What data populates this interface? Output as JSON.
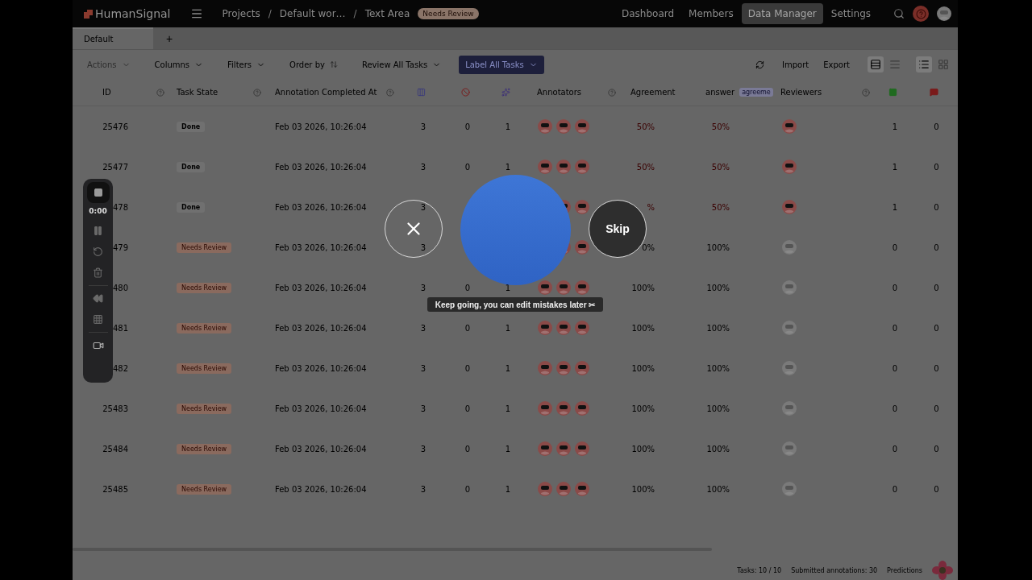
{
  "nav": {
    "logo": "HumanSignal",
    "breadcrumbs": [
      {
        "kind": "link",
        "label": "Projects"
      },
      {
        "kind": "separator",
        "label": "/"
      },
      {
        "kind": "link",
        "label": "Default wor…"
      },
      {
        "kind": "separator",
        "label": "/"
      },
      {
        "kind": "link",
        "label": "Text Area"
      }
    ],
    "status_badge": "Needs Review",
    "links": [
      {
        "label": "Dashboard",
        "selected": false
      },
      {
        "label": "Members",
        "selected": false
      },
      {
        "label": "Data Manager",
        "selected": true
      },
      {
        "label": "Settings",
        "selected": false
      }
    ]
  },
  "tabs": [
    {
      "label": "Default",
      "selected": true
    }
  ],
  "add_tab": "+",
  "toolbar": {
    "buttons": [
      {
        "label": "Actions",
        "kind": "menu",
        "disabled": true
      },
      {
        "label": "Columns",
        "kind": "menu",
        "disabled": false
      },
      {
        "label": "Filters",
        "kind": "menu",
        "disabled": false
      },
      {
        "label": "Order by",
        "kind": "sort",
        "disabled": false
      },
      {
        "label": "Review All Tasks",
        "kind": "menu",
        "disabled": false
      },
      {
        "label": "Label All Tasks",
        "kind": "primary",
        "disabled": false
      }
    ],
    "actions": [
      "Import",
      "Export"
    ],
    "density_modes": [
      {
        "selected": true
      },
      {
        "selected": false
      }
    ],
    "view_modes": [
      {
        "selected": true
      },
      {
        "selected": false
      }
    ]
  },
  "table": {
    "columns": [
      {
        "kind": "text",
        "label": "ID",
        "help": true
      },
      {
        "kind": "text",
        "label": "Task State",
        "help": true
      },
      {
        "kind": "text",
        "label": "Annotation Completed At",
        "help": true
      },
      {
        "kind": "icon"
      },
      {
        "kind": "icon"
      },
      {
        "kind": "icon"
      },
      {
        "kind": "text",
        "label": "Annotators",
        "help": true
      },
      {
        "kind": "text",
        "label": "Agreement",
        "help": false
      },
      {
        "kind": "text",
        "label": "answer",
        "help": false,
        "badge": "agreeme"
      },
      {
        "kind": "text",
        "label": "Reviewers",
        "help": true
      },
      {
        "kind": "icon"
      },
      {
        "kind": "icon"
      }
    ],
    "rows": [
      {
        "id": "25476",
        "state": "Done",
        "kind": "done",
        "completed_at": "Feb 03 2026, 10:26:04",
        "total": "3",
        "cancelled": "0",
        "predictions": "1",
        "annotators": [
          {
            "kind": "avatar"
          },
          {
            "kind": "avatar"
          },
          {
            "kind": "avatar"
          }
        ],
        "agreement": "50%",
        "answer": "50%",
        "low": true,
        "reviewed": true,
        "reviews": "1",
        "column_12": "0"
      },
      {
        "id": "25477",
        "state": "Done",
        "kind": "done",
        "completed_at": "Feb 03 2026, 10:26:04",
        "total": "3",
        "cancelled": "0",
        "predictions": "1",
        "annotators": [
          {
            "kind": "avatar"
          },
          {
            "kind": "avatar"
          },
          {
            "kind": "avatar"
          }
        ],
        "agreement": "50%",
        "answer": "50%",
        "low": true,
        "reviewed": true,
        "reviews": "1",
        "column_12": "0"
      },
      {
        "id": "478",
        "state": "Done",
        "kind": "done",
        "completed_at": "Feb 03 2026, 10:26:04",
        "total": "3",
        "annotators": [
          {
            "kind": "avatar"
          },
          {
            "kind": "avatar"
          }
        ],
        "agreement": "%",
        "answer": "50%",
        "low": true,
        "reviewed": true,
        "reviews": "1",
        "column_12": "0"
      },
      {
        "id": "479",
        "state": "Needs Review",
        "kind": "review",
        "completed_at": "Feb 03 2026, 10:26:04",
        "total": "3",
        "annotators": [
          {
            "kind": "avatar"
          },
          {
            "kind": "avatar"
          }
        ],
        "agreement": "0%",
        "answer": "100%",
        "low": false,
        "reviewed": false,
        "reviews": "0",
        "column_12": "0"
      },
      {
        "id": "480",
        "state": "Needs Review",
        "kind": "review",
        "completed_at": "Feb 03 2026, 10:26:04",
        "total": "3",
        "cancelled": "0",
        "predictions": "1",
        "annotators": [
          {
            "kind": "avatar"
          },
          {
            "kind": "avatar"
          },
          {
            "kind": "avatar"
          }
        ],
        "agreement": "100%",
        "answer": "100%",
        "low": false,
        "reviewed": false,
        "reviews": "0",
        "column_12": "0"
      },
      {
        "id": "481",
        "state": "Needs Review",
        "kind": "review",
        "completed_at": "Feb 03 2026, 10:26:04",
        "total": "3",
        "cancelled": "0",
        "predictions": "1",
        "annotators": [
          {
            "kind": "avatar"
          },
          {
            "kind": "avatar"
          },
          {
            "kind": "avatar"
          }
        ],
        "agreement": "100%",
        "answer": "100%",
        "low": false,
        "reviewed": false,
        "reviews": "0",
        "column_12": "0"
      },
      {
        "id": "482",
        "state": "Needs Review",
        "kind": "review",
        "completed_at": "Feb 03 2026, 10:26:04",
        "total": "3",
        "cancelled": "0",
        "predictions": "1",
        "annotators": [
          {
            "kind": "avatar"
          },
          {
            "kind": "avatar"
          },
          {
            "kind": "avatar"
          }
        ],
        "agreement": "100%",
        "answer": "100%",
        "low": false,
        "reviewed": false,
        "reviews": "0",
        "column_12": "0"
      },
      {
        "id": "25483",
        "state": "Needs Review",
        "kind": "review",
        "completed_at": "Feb 03 2026, 10:26:04",
        "total": "3",
        "cancelled": "0",
        "predictions": "1",
        "annotators": [
          {
            "kind": "avatar"
          },
          {
            "kind": "avatar"
          },
          {
            "kind": "avatar"
          }
        ],
        "agreement": "100%",
        "answer": "100%",
        "low": false,
        "reviewed": false,
        "reviews": "0",
        "column_12": "0"
      },
      {
        "id": "25484",
        "state": "Needs Review",
        "kind": "review",
        "completed_at": "Feb 03 2026, 10:26:04",
        "total": "3",
        "cancelled": "0",
        "predictions": "1",
        "annotators": [
          {
            "kind": "avatar"
          },
          {
            "kind": "avatar"
          },
          {
            "kind": "avatar"
          }
        ],
        "agreement": "100%",
        "answer": "100%",
        "low": false,
        "reviewed": false,
        "reviews": "0",
        "column_12": "0"
      },
      {
        "id": "25485",
        "state": "Needs Review",
        "kind": "review",
        "completed_at": "Feb 03 2026, 10:26:04",
        "total": "3",
        "cancelled": "0",
        "predictions": "1",
        "annotators": [
          {
            "kind": "avatar"
          },
          {
            "kind": "avatar"
          },
          {
            "kind": "avatar"
          }
        ],
        "agreement": "100%",
        "answer": "100%",
        "low": false,
        "reviewed": false,
        "reviews": "0",
        "column_12": "0"
      }
    ]
  },
  "footer": {
    "tasks": "Tasks: 10 / 10",
    "submitted": "Submitted annotations: 30",
    "predictions": "Predictions"
  },
  "recorder": {
    "time": "0:00"
  },
  "overlay": {
    "skip": "Skip",
    "hint": "Keep going, you can edit mistakes later ✂"
  }
}
